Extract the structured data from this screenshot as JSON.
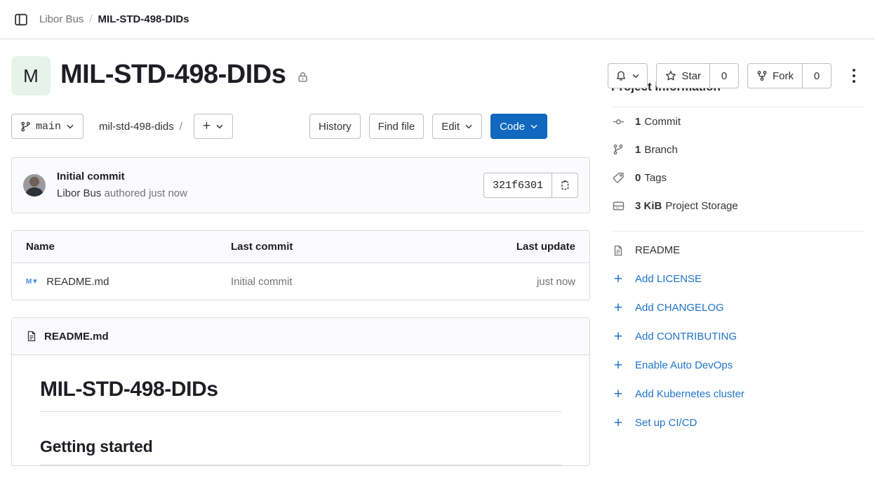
{
  "topbar": {
    "sidebar_toggle_name": "sidebar-toggle-icon",
    "breadcrumb": {
      "owner": "Libor Bus",
      "separator": "/",
      "current": "MIL-STD-498-DIDs"
    }
  },
  "project": {
    "avatar_initial": "M",
    "avatar_bg": "#e6f3ea",
    "title": "MIL-STD-498-DIDs",
    "visibility_icon": "lock-icon"
  },
  "header_actions": {
    "notifications_icon": "bell-icon",
    "star_label": "Star",
    "star_count": "0",
    "fork_label": "Fork",
    "fork_count": "0",
    "more_actions_icon": "ellipsis-vertical-icon"
  },
  "toolbar": {
    "branch": "main",
    "path": "mil-std-498-dids",
    "path_separator": "/",
    "add_label": "+",
    "history_label": "History",
    "find_file_label": "Find file",
    "edit_label": "Edit",
    "code_label": "Code",
    "code_button_color": "#1068bf"
  },
  "commit": {
    "title": "Initial commit",
    "author": "Libor Bus",
    "action": "authored",
    "time": "just now",
    "sha": "321f6301",
    "copy_icon": "clipboard-copy-icon"
  },
  "files": {
    "columns": [
      "Name",
      "Last commit",
      "Last update"
    ],
    "rows": [
      {
        "icon": "markdown-file-icon",
        "name": "README.md",
        "last_commit": "Initial commit",
        "last_update": "just now"
      }
    ]
  },
  "readme": {
    "header_icon": "document-icon",
    "header_title": "README.md",
    "h1": "MIL-STD-498-DIDs",
    "h2": "Getting started"
  },
  "sidebar": {
    "project_information_title": "Project information",
    "stats": [
      {
        "icon": "commit-icon",
        "value": "1",
        "label": "Commit"
      },
      {
        "icon": "branch-icon",
        "value": "1",
        "label": "Branch"
      },
      {
        "icon": "tag-icon",
        "value": "0",
        "label": "Tags"
      },
      {
        "icon": "storage-icon",
        "value": "3 KiB",
        "label": "Project Storage"
      }
    ],
    "links": [
      {
        "icon": "document-icon",
        "label": "README",
        "style": "plain"
      },
      {
        "icon": "plus-icon",
        "label": "Add LICENSE",
        "style": "link"
      },
      {
        "icon": "plus-icon",
        "label": "Add CHANGELOG",
        "style": "link"
      },
      {
        "icon": "plus-icon",
        "label": "Add CONTRIBUTING",
        "style": "link"
      },
      {
        "icon": "plus-icon",
        "label": "Enable Auto DevOps",
        "style": "link"
      },
      {
        "icon": "plus-icon",
        "label": "Add Kubernetes cluster",
        "style": "link"
      },
      {
        "icon": "plus-icon",
        "label": "Set up CI/CD",
        "style": "link"
      }
    ],
    "link_color": "#1f75cb"
  }
}
